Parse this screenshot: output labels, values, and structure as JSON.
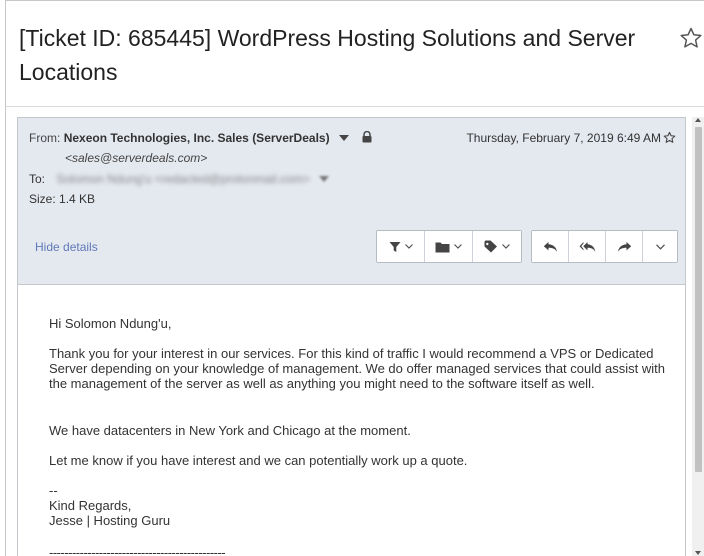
{
  "subject": "[Ticket ID: 685445] WordPress Hosting Solutions and Server Locations",
  "header": {
    "from_label": "From:",
    "from_name": "Nexeon Technologies, Inc. Sales (ServerDeals)",
    "from_email": "<sales@serverdeals.com>",
    "to_label": "To:",
    "to_value": "Solomon Ndung'u <redacted@protonmail.com>",
    "size_label": "Size:",
    "size_value": "1.4 KB",
    "date": "Thursday, February 7, 2019 6:49 AM",
    "hide_details": "Hide details"
  },
  "toolbar": {
    "icons": [
      "filter-icon",
      "folder-icon",
      "tag-icon",
      "reply-icon",
      "reply-all-icon",
      "forward-icon",
      "more-icon"
    ]
  },
  "body": {
    "greeting": "Hi Solomon Ndung'u,",
    "main": "Thank you for your interest in our services. For this kind of traffic I would recommend a VPS or Dedicated Server depending on your knowledge of management. We do offer managed services that could assist with the management of the server as well as anything you might need to the software itself as well.",
    "datacenters": "We have datacenters in New York and Chicago at the moment.",
    "let_me_know": "Let me know if you have interest and we can potentially work up a quote.",
    "dash": "--",
    "regards": "Kind Regards,",
    "signature": "Jesse | Hosting Guru",
    "separator": "----------------------------------------------"
  },
  "colors": {
    "header_bg": "#e4e8ef",
    "link": "#6079b8"
  }
}
